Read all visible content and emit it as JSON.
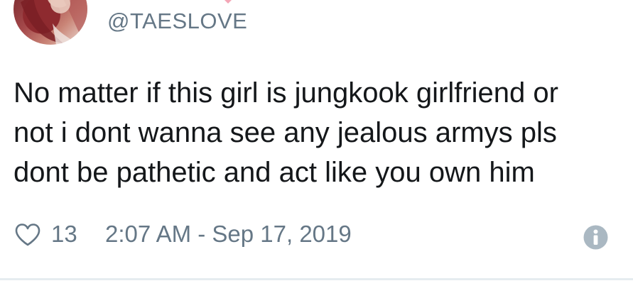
{
  "tweet": {
    "handle": "@TAESLOVE",
    "text_lines": [
      "No matter if this girl is jungkook girlfriend or",
      "not i dont wanna see any jealous armys pls",
      "dont be pathetic and act like you own him"
    ],
    "like_count": "13",
    "timestamp": "2:07 AM - Sep 17, 2019"
  },
  "icons": {
    "like": "heart-outline-icon",
    "info": "info-icon",
    "decoration": "pink-heart-icon"
  },
  "colors": {
    "text": "#14171a",
    "secondary": "#657786",
    "info_icon": "#aab8c2",
    "accent_heart": "#f4a6b6",
    "divider": "#e6ecf0"
  }
}
